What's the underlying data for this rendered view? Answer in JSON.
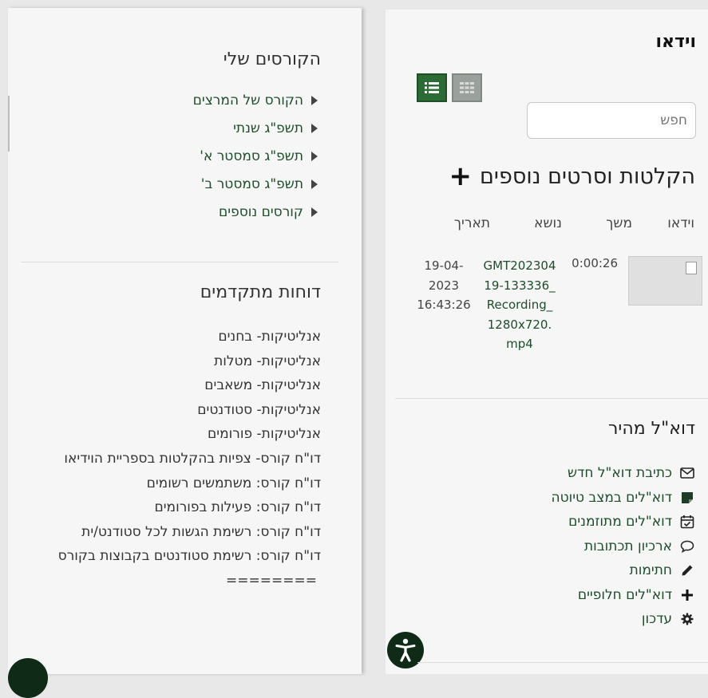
{
  "left_panel": {
    "courses_title": "הקורסים שלי",
    "courses": [
      "הקורס של המרצים",
      "תשפ\"ג שנתי",
      "תשפ\"ג סמסטר א'",
      "תשפ\"ג סמסטר ב'",
      "קורסים נוספים"
    ],
    "reports_title": "דוחות מתקדמים",
    "reports": [
      "אנליטיקות- בחנים",
      "אנליטיקות- מטלות",
      "אנליטיקות- משאבים",
      "אנליטיקות- סטודנטים",
      "אנליטיקות- פורומים",
      "דו\"ח קורס- צפיות בהקלטות בספריית הוידיאו",
      "דו\"ח קורס: משתמשים רשומים",
      "דו\"ח קורס: פעילות בפורומים",
      "דו\"ח קורס: רשימת הגשות לכל סטודנט/ית",
      "דו\"ח קורס: רשימת סטודנטים בקבוצות בקורס",
      "========"
    ]
  },
  "right_panel": {
    "video_title": "וידאו",
    "search_placeholder": "חפש",
    "recordings_title": "הקלטות וסרטים נוספים",
    "table": {
      "headers": {
        "video": "וידאו",
        "duration": "משך",
        "topic": "נושא",
        "date": "תאריך"
      },
      "rows": [
        {
          "duration": "0:00:26",
          "topic": "GMT20230419-133336_Recording_1280x720.mp4",
          "date": "19-04-2023 16:43:26"
        }
      ]
    },
    "mail_title": "דוא\"ל מהיר",
    "mail_items": [
      {
        "label": "כתיבת דוא\"ל חדש",
        "icon": "envelope-icon"
      },
      {
        "label": "דוא\"לים במצב טיוטה",
        "icon": "sticky-note-icon"
      },
      {
        "label": "דוא\"לים מתוזמנים",
        "icon": "calendar-check-icon"
      },
      {
        "label": "ארכיון תכתובות",
        "icon": "comment-icon"
      },
      {
        "label": "חתימות",
        "icon": "pencil-icon"
      },
      {
        "label": "דוא\"לים חלופיים",
        "icon": "plus-icon"
      },
      {
        "label": "עדכון",
        "icon": "gear-icon"
      }
    ]
  },
  "colors": {
    "accent": "#2c6b35",
    "link": "#1d4d2b",
    "dark_badge": "#0f2a17"
  }
}
